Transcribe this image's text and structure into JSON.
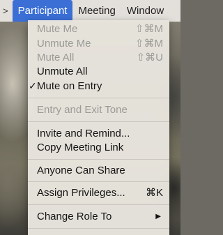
{
  "menubar": {
    "items": [
      ">",
      "Participant",
      "Meeting",
      "Window"
    ]
  },
  "menu": {
    "mute_me": {
      "label": "Mute Me",
      "shortcut": "⇧⌘M"
    },
    "unmute_me": {
      "label": "Unmute Me",
      "shortcut": "⇧⌘M"
    },
    "mute_all": {
      "label": "Mute All",
      "shortcut": "⇧⌘U"
    },
    "unmute_all": {
      "label": "Unmute All"
    },
    "mute_on_entry": {
      "label": "Mute on Entry",
      "checkmark": "✓"
    },
    "entry_exit_tone": {
      "label": "Entry and Exit Tone"
    },
    "invite_remind": {
      "label": "Invite and Remind..."
    },
    "copy_link": {
      "label": "Copy Meeting Link"
    },
    "anyone_share": {
      "label": "Anyone Can Share"
    },
    "assign_privileges": {
      "label": "Assign Privileges...",
      "shortcut": "⌘K"
    },
    "change_role": {
      "label": "Change Role To",
      "submenu_arrow": "▶"
    }
  },
  "colors": {
    "highlight": "#3b6fd6",
    "menu_bg": "#e8e5de",
    "disabled_text": "#9b9a96"
  }
}
